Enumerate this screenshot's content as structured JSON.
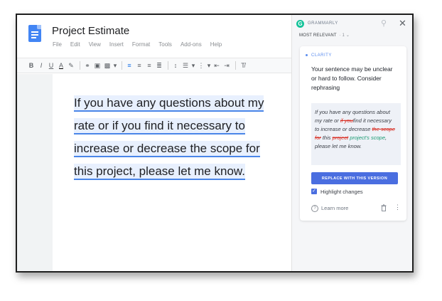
{
  "doc": {
    "title": "Project Estimate",
    "menu": [
      "File",
      "Edit",
      "View",
      "Insert",
      "Format",
      "Tools",
      "Add-ons",
      "Help"
    ],
    "toolbar": {
      "bold": "B",
      "italic": "I",
      "underline": "U",
      "text_color": "A",
      "highlight_icon": "highlighter-icon",
      "link_icon": "link-icon",
      "comment_icon": "comment-icon",
      "image_icon": "image-icon",
      "align_left_icon": "align-left-icon",
      "align_center_icon": "align-center-icon",
      "align_right_icon": "align-right-icon",
      "justify_icon": "justify-icon",
      "line_spacing_icon": "line-spacing-icon",
      "checklist_icon": "checklist-icon",
      "bullets_icon": "bullets-icon",
      "numbered_icon": "numbered-icon",
      "indent_decrease_icon": "indent-decrease-icon",
      "indent_increase_icon": "indent-increase-icon",
      "clear_format_icon": "clear-formatting-icon"
    },
    "body_lines": [
      "If you have any questions about my",
      "rate or if you find it necessary to",
      "increase or decrease the scope for",
      "this project, please let me know."
    ]
  },
  "grammarly": {
    "brand": "GRAMMARLY",
    "sort_label": "MOST RELEVANT",
    "sort_count": "1",
    "category": "CLARITY",
    "message": "Your sentence may be unclear or hard to follow. Consider rephrasing",
    "suggestion": {
      "part1": "If you have any questions about my rate or ",
      "del1": "if you",
      "part2": "find it necessary to increase or decrease ",
      "del2": "the scope for",
      "part3": " this ",
      "del3": "project",
      "ins1": "project's scope",
      "part4": ", please let me know."
    },
    "replace_button": "REPLACE WITH THIS VERSION",
    "highlight_changes": "Highlight changes",
    "highlight_checked": true,
    "learn_more": "Learn more",
    "accent_color": "#15c39a",
    "button_color": "#4a6ee0"
  }
}
